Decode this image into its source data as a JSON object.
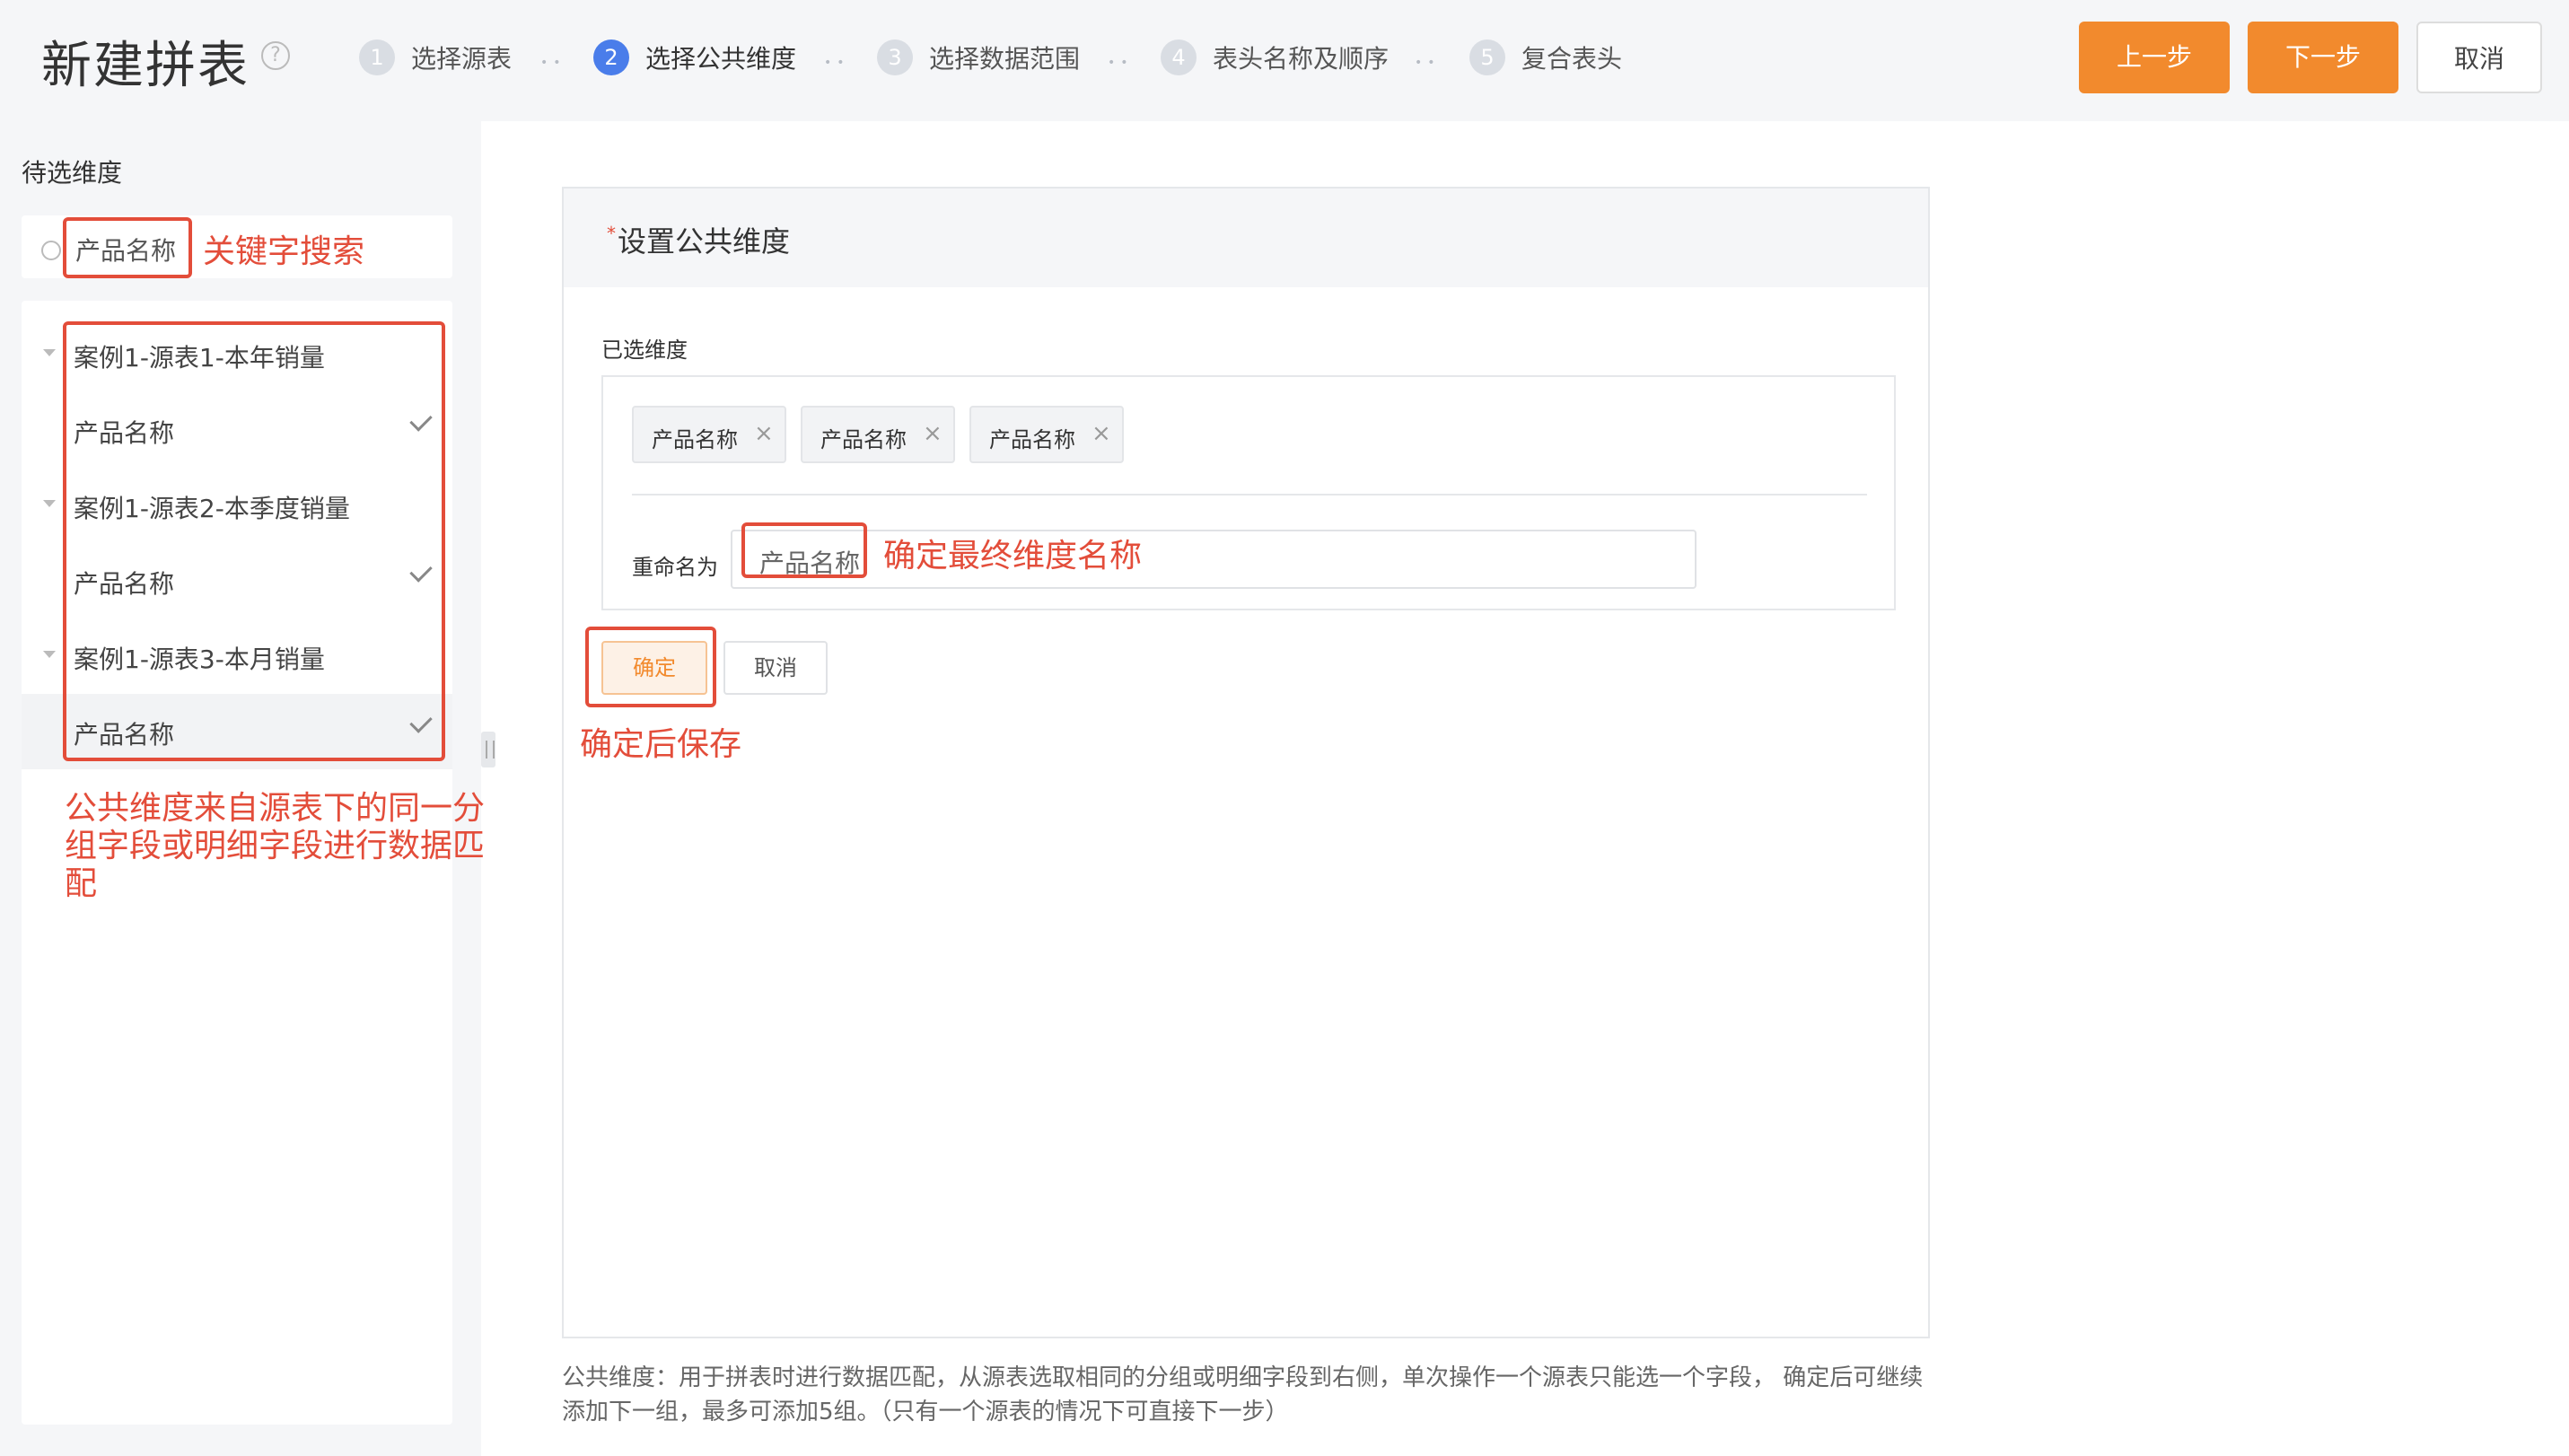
{
  "header": {
    "title": "新建拼表",
    "help_icon": "?",
    "steps": [
      {
        "num": "1",
        "label": "选择源表"
      },
      {
        "num": "2",
        "label": "选择公共维度"
      },
      {
        "num": "3",
        "label": "选择数据范围"
      },
      {
        "num": "4",
        "label": "表头名称及顺序"
      },
      {
        "num": "5",
        "label": "复合表头"
      }
    ],
    "active_step": 2,
    "prev_label": "上一步",
    "next_label": "下一步",
    "cancel_label": "取消"
  },
  "sidebar": {
    "title": "待选维度",
    "search_value": "产品名称",
    "tree": [
      {
        "label": "案例1-源表1-本年销量",
        "type": "group"
      },
      {
        "label": "产品名称",
        "type": "field",
        "checked": true
      },
      {
        "label": "案例1-源表2-本季度销量",
        "type": "group"
      },
      {
        "label": "产品名称",
        "type": "field",
        "checked": true
      },
      {
        "label": "案例1-源表3-本月销量",
        "type": "group"
      },
      {
        "label": "产品名称",
        "type": "field",
        "checked": true
      }
    ]
  },
  "main": {
    "required_mark": "*",
    "card_title": "设置公共维度",
    "selected_label": "已选维度",
    "tags": [
      "产品名称",
      "产品名称",
      "产品名称"
    ],
    "tag_close": "×",
    "rename_label": "重命名为",
    "rename_value": "产品名称",
    "confirm_label": "确定",
    "cancel_label": "取消",
    "footer_note": "公共维度：用于拼表时进行数据匹配，从源表选取相同的分组或明细字段到右侧，单次操作一个源表只能选一个字段， 确定后可继续添加下一组，最多可添加5组。（只有一个源表的情况下可直接下一步）"
  },
  "annotations": {
    "search": "关键字搜索",
    "public_dimension": "公共维度来自源表下的同一分组字段或明细字段进行数据匹配",
    "rename": "确定最终维度名称",
    "confirm": "确定后保存"
  },
  "colors": {
    "accent_orange": "#f28a2d",
    "active_step_blue": "#4a7dea",
    "annotation_red": "#e34d3a"
  }
}
